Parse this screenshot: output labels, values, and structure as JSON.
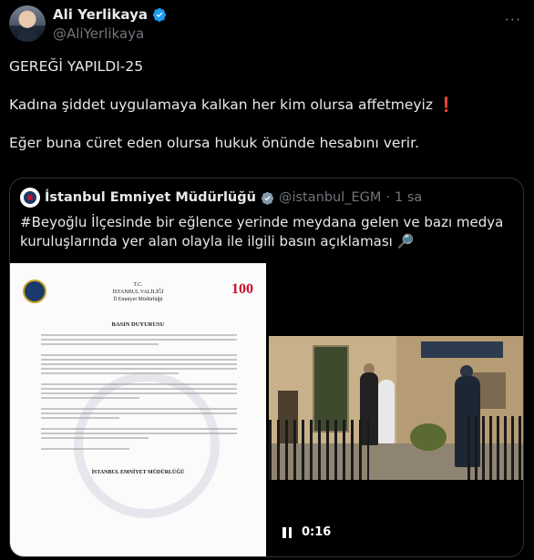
{
  "author": {
    "display_name": "Ali Yerlikaya",
    "handle": "@AliYerlikaya"
  },
  "more_glyph": "···",
  "tweet": {
    "line1": "GEREĞİ YAPILDI-25",
    "line2": "Kadına şiddet uygulamaya kalkan her kim olursa affetmeyiz",
    "line2_emoji": "❗",
    "line3": "Eğer buna cüret eden olursa hukuk önünde hesabını verir."
  },
  "quote": {
    "display_name": "İstanbul Emniyet Müdürlüğü",
    "handle": "@istanbul_EGM",
    "separator": "·",
    "time_ago": "1 sa",
    "text": "#Beyoğlu İlçesinde bir eğlence yerinde meydana gelen ve bazı medya kuruluşlarında yer alan olayla ile ilgili basın açıklaması",
    "text_emoji": "🔎"
  },
  "document": {
    "header_line1": "T.C.",
    "header_line2": "İSTANBUL VALİLİĞİ",
    "header_line3": "İl Emniyet Müdürlüğü",
    "logo_right": "100",
    "title": "BASIN DUYURUSU",
    "signature": "İSTANBUL EMNİYET MÜDÜRLÜĞÜ"
  },
  "video": {
    "time": "0:16"
  },
  "colors": {
    "background": "#000000",
    "text": "#e7e9ea",
    "secondary": "#71767b",
    "verified_blue": "#1d9bf0",
    "alert_red": "#f4212e"
  }
}
